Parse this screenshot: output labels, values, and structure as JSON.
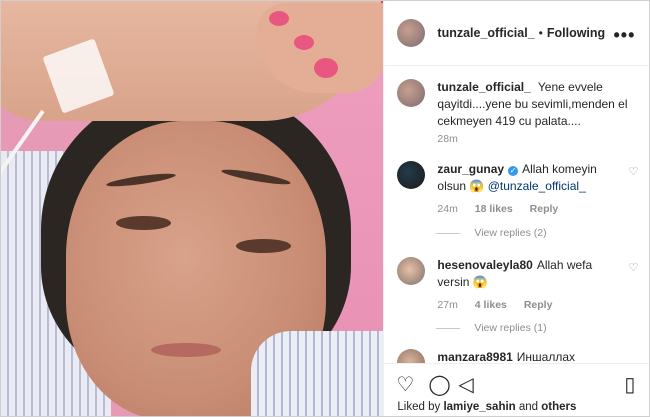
{
  "post": {
    "username": "tunzale_official_",
    "separator": "•",
    "follow_status": "Following",
    "caption": "Yene evvele qayitdi....yene bu sevimli,menden el cekmeyen 419 cu palata....",
    "caption_time": "28m"
  },
  "comments": [
    {
      "username": "zaur_gunay",
      "text": "Allah komeyin olsun 😱",
      "mention": "@tunzale_official_",
      "time": "24m",
      "likes": "18 likes",
      "reply": "Reply",
      "view_replies": "View replies (2)"
    },
    {
      "username": "hesenovaleyla80",
      "text": "Allah wefa versin 😱",
      "time": "27m",
      "likes": "4 likes",
      "reply": "Reply",
      "view_replies": "View replies (1)"
    },
    {
      "username": "manzara8981",
      "text": "Иншаллах"
    }
  ],
  "footer": {
    "liked_prefix": "Liked by",
    "liked_user": "lamiye_sahin",
    "liked_and": "and",
    "liked_others": "others"
  },
  "icons": [
    "heart-icon",
    "comment-icon",
    "share-icon",
    "bookmark-icon",
    "more-icon",
    "verified-icon"
  ],
  "colors": {
    "link": "#00376b",
    "muted": "#8e8e8e",
    "verified": "#3897f0"
  }
}
